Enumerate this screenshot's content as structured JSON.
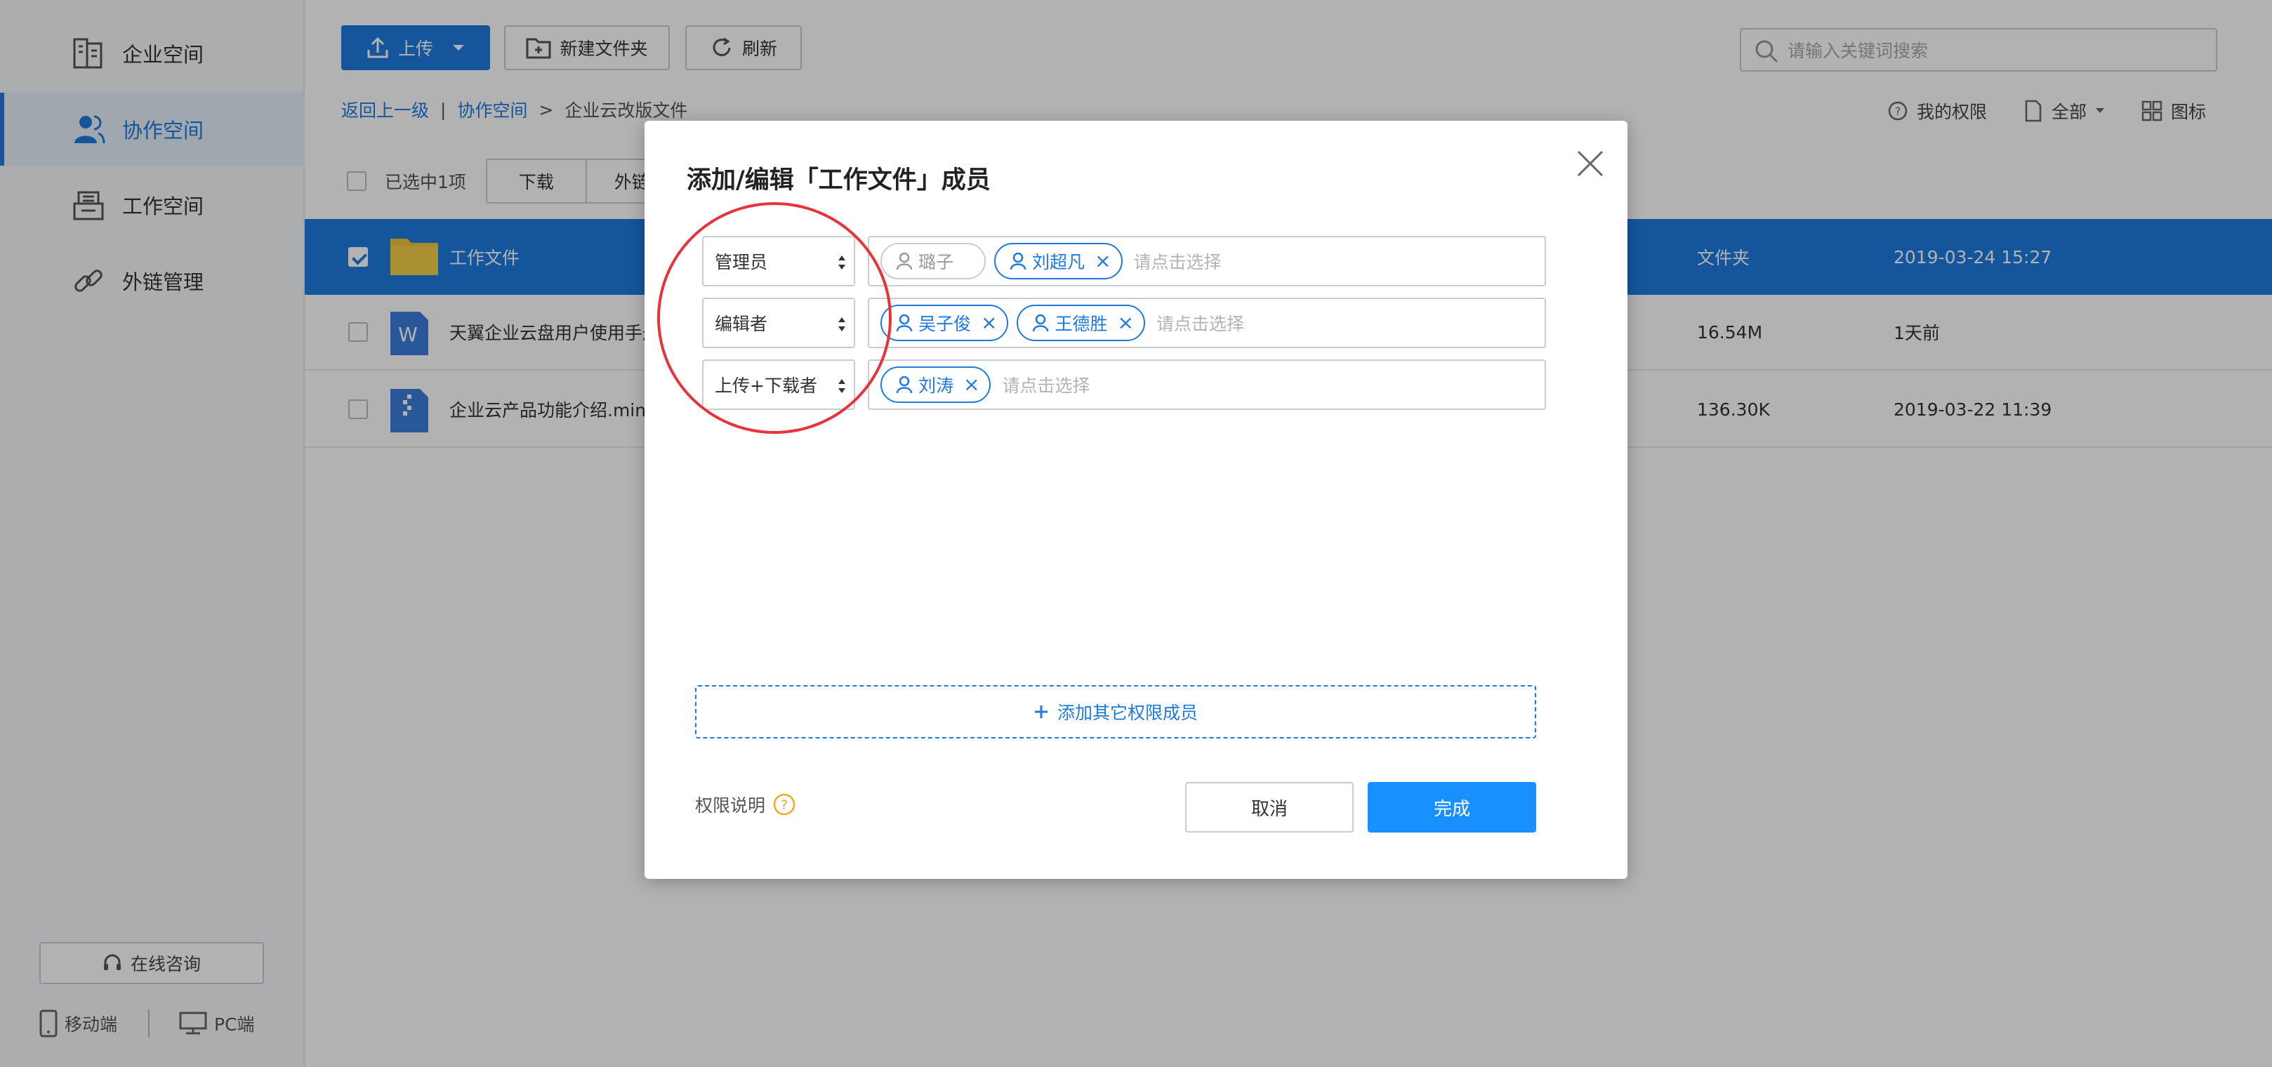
{
  "sidebar": {
    "items": [
      {
        "label": "企业空间",
        "icon": "enterprise-space-icon"
      },
      {
        "label": "协作空间",
        "icon": "collab-space-icon",
        "active": true
      },
      {
        "label": "工作空间",
        "icon": "work-space-icon"
      },
      {
        "label": "外链管理",
        "icon": "link-icon"
      }
    ],
    "consult_label": "在线咨询",
    "mobile_label": "移动端",
    "pc_label": "PC端"
  },
  "toolbar": {
    "upload_label": "上传",
    "new_folder_label": "新建文件夹",
    "refresh_label": "刷新"
  },
  "search": {
    "placeholder": "请输入关键词搜索"
  },
  "breadcrumb": {
    "back_label": "返回上一级",
    "sep1": "|",
    "collab_label": "协作空间",
    "sep2": ">",
    "current": "企业云改版文件"
  },
  "view_tools": {
    "my_permission": "我的权限",
    "filter": "全部",
    "view_mode": "图标"
  },
  "selection_bar": {
    "selected_text": "已选中1项",
    "download_label": "下载",
    "external_link_label": "外链"
  },
  "files": [
    {
      "name": "工作文件",
      "size": "文件夹",
      "time": "2019-03-24 15:27",
      "selected": true
    },
    {
      "name": "天翼企业云盘用户使用手册",
      "size": "16.54M",
      "time": "1天前"
    },
    {
      "name": "企业云产品功能介绍.mindn",
      "size": "136.30K",
      "time": "2019-03-22 11:39"
    }
  ],
  "modal": {
    "title": "添加/编辑「工作文件」成员",
    "rows": [
      {
        "role": "管理员",
        "members": [
          {
            "name": "璐子",
            "locked": true
          },
          {
            "name": "刘超凡"
          }
        ],
        "placeholder": "请点击选择"
      },
      {
        "role": "编辑者",
        "members": [
          {
            "name": "吴子俊"
          },
          {
            "name": "王德胜"
          }
        ],
        "placeholder": "请点击选择"
      },
      {
        "role": "上传+下载者",
        "members": [
          {
            "name": "刘涛"
          }
        ],
        "placeholder": "请点击选择"
      }
    ],
    "add_member_label": "添加其它权限成员",
    "perm_help_label": "权限说明",
    "cancel_label": "取消",
    "done_label": "完成"
  },
  "colors": {
    "accent": "#1f7ae0",
    "annotation": "#e8333a",
    "done": "#1890ff"
  }
}
